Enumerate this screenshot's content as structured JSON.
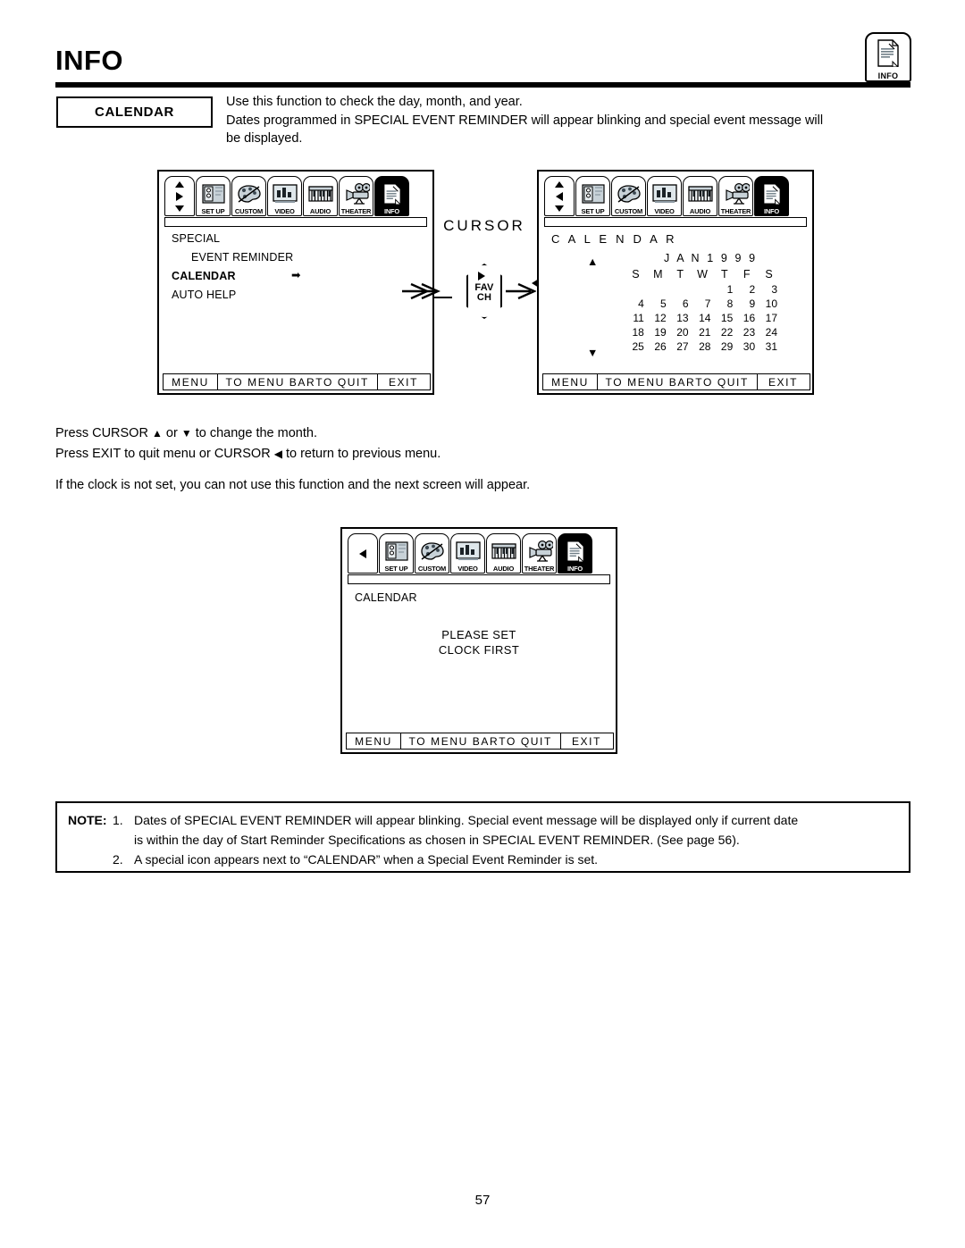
{
  "page": {
    "title": "INFO",
    "number": "57",
    "corner_icon_label": "INFO"
  },
  "section": {
    "label": "CALENDAR",
    "intro_line_1": "Use this function to check the day, month, and year.",
    "intro_line_2": "Dates programmed in SPECIAL EVENT REMINDER will appear blinking and special event message will",
    "intro_line_3": "be displayed."
  },
  "iconbar": {
    "items": [
      {
        "label": "SET UP",
        "icon": "setup-icon"
      },
      {
        "label": "CUSTOM",
        "icon": "palette-icon"
      },
      {
        "label": "VIDEO",
        "icon": "video-icon"
      },
      {
        "label": "AUDIO",
        "icon": "audio-icon"
      },
      {
        "label": "THEATER",
        "icon": "theater-icon"
      },
      {
        "label": "INFO",
        "icon": "info-icon"
      }
    ],
    "selected": "INFO"
  },
  "keybar": {
    "menu": "MENU",
    "to_menu_bar": "TO MENU BAR",
    "to_quit": "TO QUIT",
    "exit": "EXIT"
  },
  "screen_menu": {
    "items": [
      {
        "label": "SPECIAL",
        "indent": 0,
        "bold": false
      },
      {
        "label": "EVENT REMINDER",
        "indent": 1,
        "bold": false
      },
      {
        "label": "CALENDAR",
        "indent": 0,
        "bold": true
      },
      {
        "label": "AUTO HELP",
        "indent": 0,
        "bold": false
      }
    ],
    "selected_marker": "➡"
  },
  "cursor_group": {
    "label": "CURSOR",
    "button_line_1": "FAV",
    "button_line_2": "CH"
  },
  "screen_calendar": {
    "heading": "C A L E N D A R",
    "month_year": "J A N  1 9 9 9",
    "weekday_headers": [
      "S",
      "M",
      "T",
      "W",
      "T",
      "F",
      "S"
    ],
    "weeks": [
      [
        "",
        "",
        "",
        "",
        "1",
        "2",
        "3"
      ],
      [
        "4",
        "5",
        "6",
        "7",
        "8",
        "9",
        "10"
      ],
      [
        "11",
        "12",
        "13",
        "14",
        "15",
        "16",
        "17"
      ],
      [
        "18",
        "19",
        "20",
        "21",
        "22",
        "23",
        "24"
      ],
      [
        "25",
        "26",
        "27",
        "28",
        "29",
        "30",
        "31"
      ]
    ],
    "up_arrow": "▲",
    "down_arrow": "▼"
  },
  "screen_clock": {
    "heading": "CALENDAR",
    "message_line_1": "PLEASE SET",
    "message_line_2": "CLOCK FIRST"
  },
  "instructions": {
    "line_1_pre": "Press CURSOR ",
    "line_1_up": "▲",
    "line_1_mid": " or ",
    "line_1_down": "▼",
    "line_1_post": " to change the month.",
    "line_2_pre": "Press EXIT to quit menu or CURSOR ",
    "line_2_left": "◀",
    "line_2_post": " to return to previous menu.",
    "line_3": "If the clock is not set, you can not use this function and the next screen will appear."
  },
  "note": {
    "label": "NOTE:",
    "item_1_number": "1.",
    "item_1_line_1": "Dates of SPECIAL EVENT REMINDER will appear blinking.  Special event message will be displayed only if current date",
    "item_1_line_2": "is within the day of Start Reminder Specifications as chosen in SPECIAL EVENT REMINDER. (See page 56).",
    "item_2_number": "2.",
    "item_2_line_1": "A special icon appears next to “CALENDAR” when a Special Event Reminder is set."
  },
  "colors": {
    "ink": "#000000",
    "paper": "#ffffff",
    "icon_fill": "#c8d2d8",
    "icon_shade": "#8d9aa3"
  }
}
